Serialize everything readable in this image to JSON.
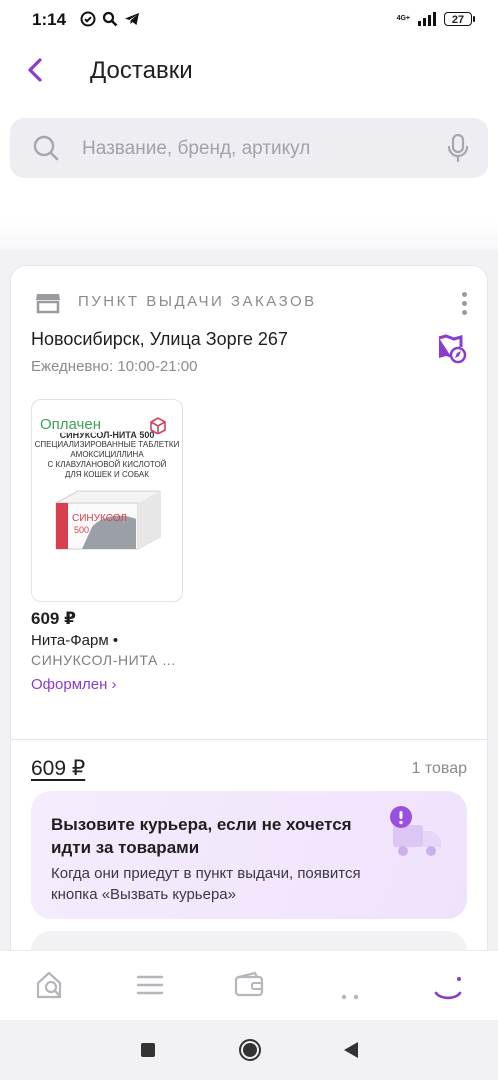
{
  "status_bar": {
    "time": "1:14",
    "network": "4G+",
    "battery": "27"
  },
  "header": {
    "title": "Доставки"
  },
  "search": {
    "placeholder": "Название, бренд, артикул"
  },
  "order": {
    "pickup_label": "ПУНКТ ВЫДАЧИ ЗАКАЗОВ",
    "address": "Новосибирск, Улица Зорге 267",
    "hours": "Ежедневно: 10:00-21:00",
    "product": {
      "payment_status": "Оплачен",
      "package_line1": "СИНУКСОЛ-НИТА 500",
      "package_line2": "СПЕЦИАЛИЗИРОВАННЫЕ ТАБЛЕТКИ",
      "package_line3": "АМОКСИЦИЛЛИНА",
      "package_line4": "С КЛАВУЛАНОВОЙ КИСЛОТОЙ",
      "package_line5": "ДЛЯ КОШЕК И СОБАК",
      "box_brand": "СИНУКСОЛ",
      "box_dose": "500",
      "price": "609 ₽",
      "seller": "Нита-Фарм •",
      "name": "СИНУКСОЛ-НИТА ...",
      "status": "Оформлен ›"
    },
    "total": "609 ₽",
    "items_count": "1 товар",
    "promo": {
      "title": "Вызовите курьера, если не хочется идти за товарами",
      "text": "Когда они приедут в пункт выдачи, появится кнопка «Вызвать курьера»"
    }
  },
  "colors": {
    "accent": "#8b3ccf",
    "paid_green": "#3ba354",
    "promo_bg": "#f3e8fd"
  },
  "icons": {
    "back": "chevron-left-icon",
    "search": "search-icon",
    "mic": "microphone-icon",
    "pickup": "store-icon",
    "map": "map-compass-icon",
    "gift": "gift-box-icon",
    "truck": "delivery-truck-icon"
  },
  "bottom_nav": [
    "home-search-icon",
    "menu-icon",
    "wallet-icon",
    "more-icon",
    "profile-icon"
  ]
}
